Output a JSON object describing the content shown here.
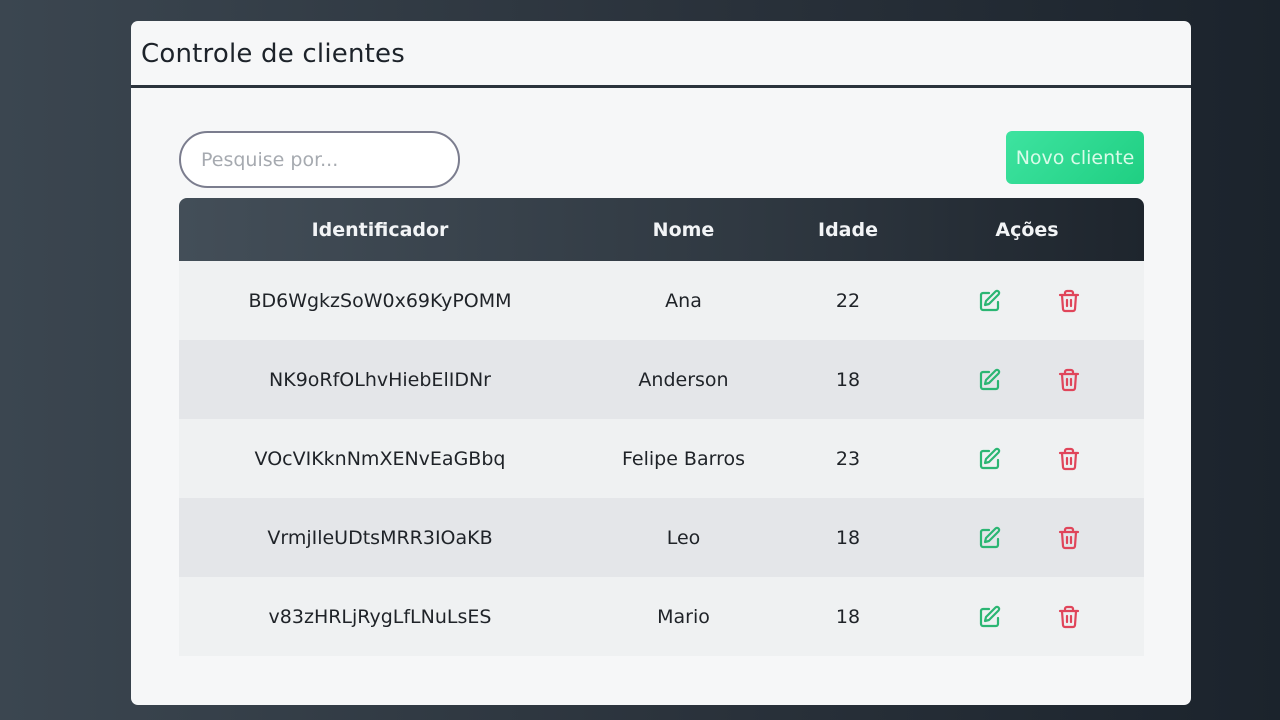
{
  "header": {
    "title": "Controle de clientes"
  },
  "search": {
    "placeholder": "Pesquise por..."
  },
  "toolbar": {
    "new_client_label": "Novo cliente"
  },
  "table": {
    "columns": [
      "Identificador",
      "Nome",
      "Idade",
      "Ações"
    ],
    "rows": [
      {
        "id": "BD6WgkzSoW0x69KyPOMM",
        "name": "Ana",
        "age": "22"
      },
      {
        "id": "NK9oRfOLhvHiebElIDNr",
        "name": "Anderson",
        "age": "18"
      },
      {
        "id": "VOcVIKknNmXENvEaGBbq",
        "name": "Felipe Barros",
        "age": "23"
      },
      {
        "id": "VrmjIleUDtsMRR3IOaKB",
        "name": "Leo",
        "age": "18"
      },
      {
        "id": "v83zHRLjRygLfLNuLsES",
        "name": "Mario",
        "age": "18"
      }
    ]
  },
  "icons": {
    "edit": "edit-icon",
    "delete": "trash-icon"
  },
  "colors": {
    "edit": "#2bb673",
    "delete": "#e0455a",
    "accent": "#22d38a"
  }
}
